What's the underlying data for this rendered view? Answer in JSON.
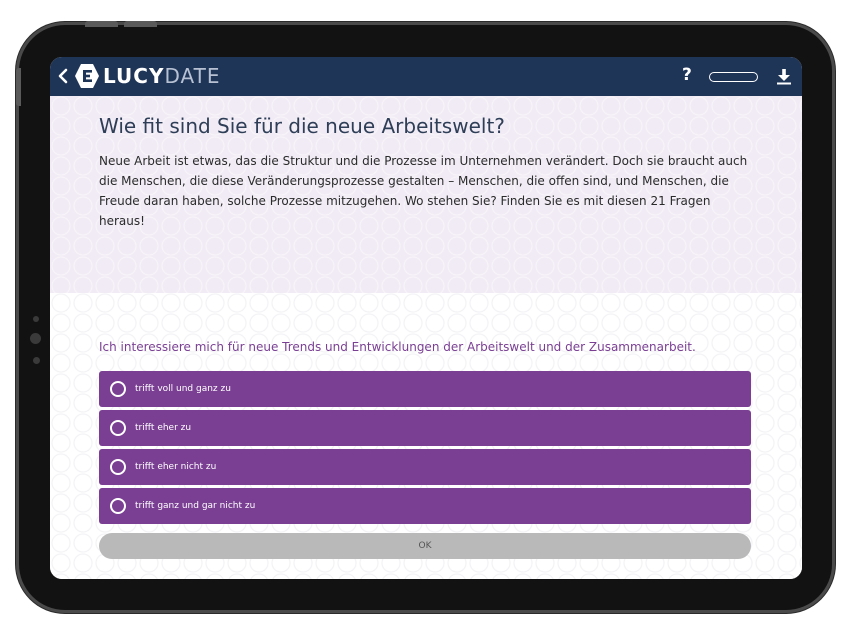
{
  "header": {
    "logo_bold": "LUCY",
    "logo_light": "DATE",
    "help_label": "?"
  },
  "intro": {
    "title": "Wie fit sind Sie für die neue Arbeitswelt?",
    "text": "Neue Arbeit ist etwas, das die Struktur und die Prozesse im Unternehmen verändert. Doch sie braucht auch die Menschen, die diese Veränderungsprozesse gestalten – Menschen, die offen sind, und Menschen, die Freude daran haben, solche Prozesse mitzugehen. Wo stehen Sie? Finden Sie es mit diesen 21 Fragen heraus!"
  },
  "question": {
    "text": "Ich interessiere mich für neue Trends und Entwicklungen der Arbeitswelt und der Zusammenarbeit.",
    "options": [
      "trifft voll und ganz zu",
      "trifft eher zu",
      "trifft eher nicht zu",
      "trifft ganz und gar nicht zu"
    ],
    "ok_label": "OK"
  },
  "colors": {
    "header_bg": "#1f3558",
    "accent": "#7a3f93",
    "intro_bg": "#f1ebf5",
    "ok_bg": "#b9b9b9"
  },
  "icons": {
    "back": "chevron-left-icon",
    "logo": "lucydate-logo-icon",
    "help": "question-mark-icon",
    "progress": "progress-pill",
    "download": "download-icon",
    "radio": "radio-empty-icon"
  }
}
